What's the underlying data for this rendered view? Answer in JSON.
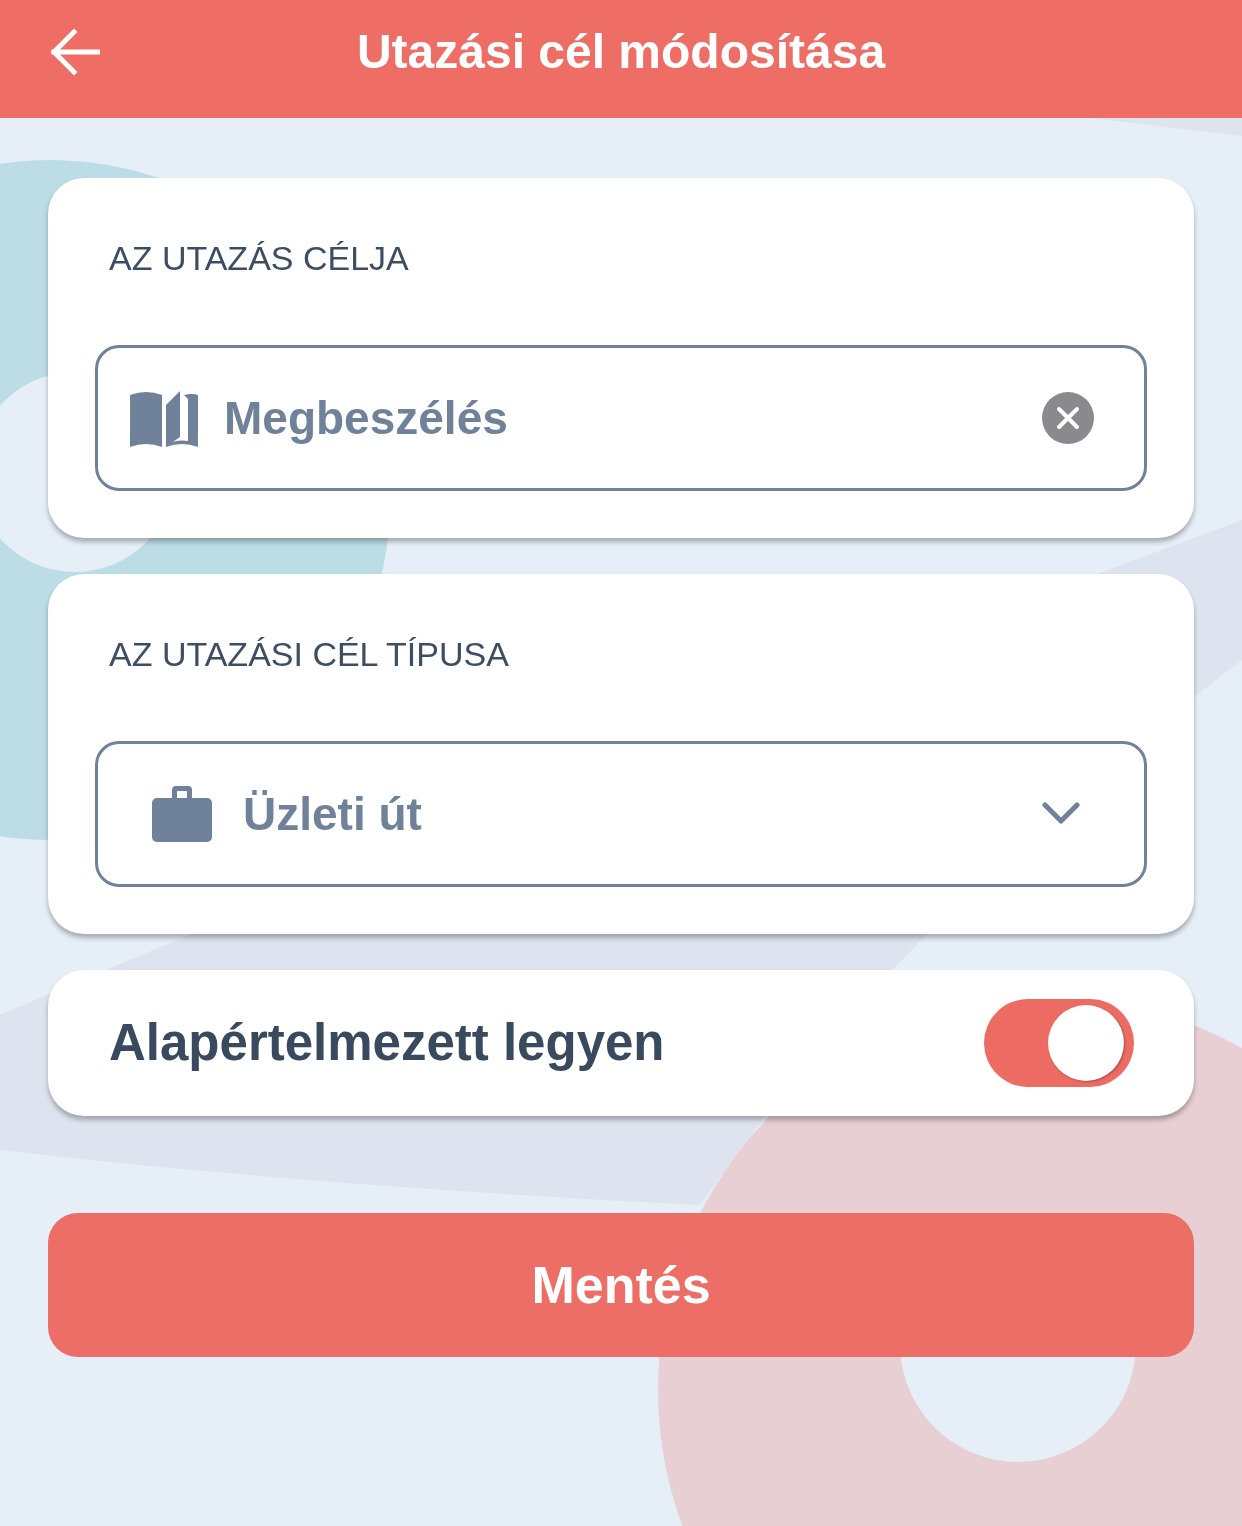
{
  "header": {
    "title": "Utazási cél módosítása"
  },
  "fields": [
    {
      "kind": "text",
      "label": "AZ UTAZÁS CÉLJA",
      "value": "Megbeszélés"
    },
    {
      "kind": "select",
      "label": "AZ UTAZÁSI CÉL TÍPUSA",
      "value": "Üzleti út"
    }
  ],
  "default_toggle": {
    "label": "Alapértelmezett legyen",
    "on": true
  },
  "save_button": {
    "label": "Mentés"
  }
}
